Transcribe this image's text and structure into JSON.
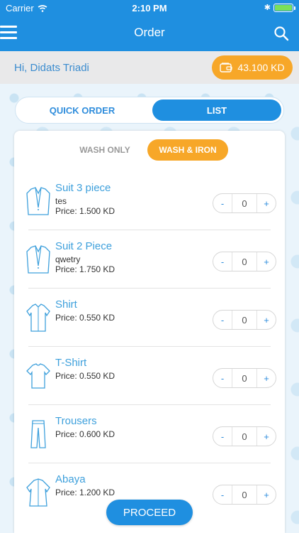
{
  "status": {
    "carrier": "Carrier",
    "time": "2:10 PM",
    "battery_level": 1.0
  },
  "nav": {
    "title": "Order",
    "menu_icon": "hamburger-icon",
    "search_icon": "search-icon"
  },
  "greeting": {
    "text": "Hi, Didats Triadi",
    "wallet_amount": "43.100 KD",
    "wallet_icon": "wallet-icon"
  },
  "toggle": {
    "left": "QUICK ORDER",
    "right": "LIST",
    "selected": "LIST"
  },
  "service_tabs": {
    "wash": "WASH ONLY",
    "iron": "WASH & IRON",
    "selected": "WASH & IRON"
  },
  "items": [
    {
      "name": "Suit 3 piece",
      "desc": "tes",
      "price": "Price: 1.500 KD",
      "qty": "0",
      "icon": "suit-icon"
    },
    {
      "name": "Suit 2 Piece",
      "desc": "qwetry",
      "price": "Price: 1.750 KD",
      "qty": "0",
      "icon": "suit-icon"
    },
    {
      "name": "Shirt",
      "desc": "",
      "price": "Price: 0.550 KD",
      "qty": "0",
      "icon": "shirt-icon"
    },
    {
      "name": "T-Shirt",
      "desc": "",
      "price": "Price: 0.550 KD",
      "qty": "0",
      "icon": "tshirt-icon"
    },
    {
      "name": "Trousers",
      "desc": "",
      "price": "Price: 0.600 KD",
      "qty": "0",
      "icon": "trousers-icon"
    },
    {
      "name": "Abaya",
      "desc": "",
      "price": "Price: 1.200 KD",
      "qty": "0",
      "icon": "abaya-icon"
    }
  ],
  "stepper": {
    "minus": "-",
    "plus": "+"
  },
  "proceed": "PROCEED",
  "colors": {
    "primary": "#1f8fe0",
    "accent": "#f7a728",
    "link": "#3ea0dc"
  }
}
